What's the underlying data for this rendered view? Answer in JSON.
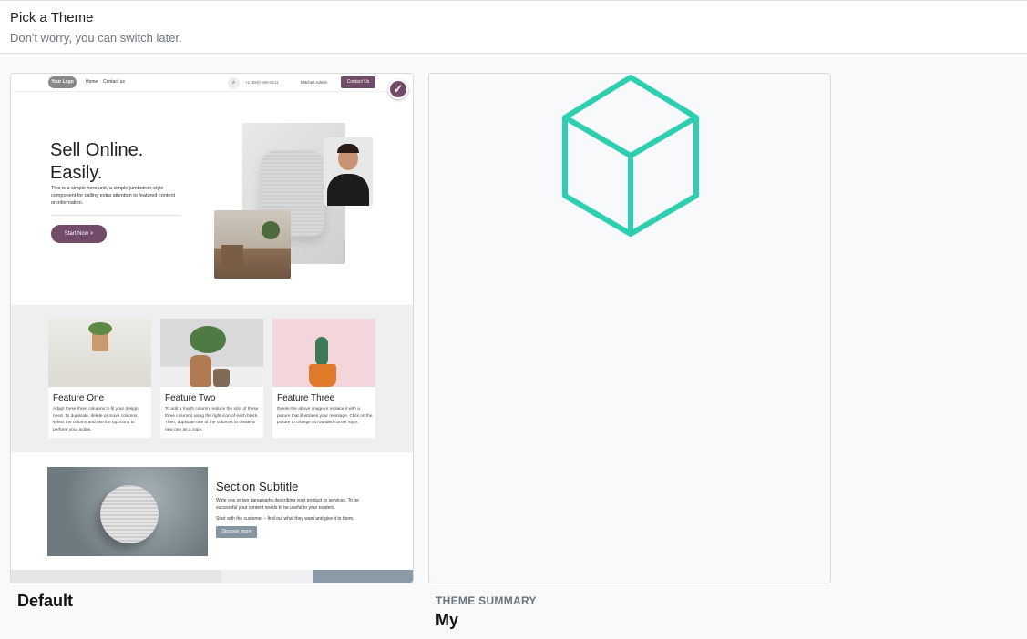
{
  "header": {
    "title": "Pick a Theme",
    "subtitle": "Don't worry, you can switch later."
  },
  "colors": {
    "accent": "#714b67",
    "cube_icon": "#2ecfb0"
  },
  "themes": [
    {
      "name": "Default",
      "selected": true,
      "preview": {
        "logo": "Your Logo",
        "nav_links": [
          "Home",
          "Contact us"
        ],
        "search_icon": "search-icon",
        "phone": "+1 (650) 555-0111",
        "user": "Mitchell Admin",
        "contact_button": "Contact Us",
        "hero_title_line1": "Sell Online.",
        "hero_title_line2": "Easily.",
        "hero_text": "This is a simple hero unit, a simple jumbotron-style component for calling extra attention to featured content or information.",
        "hero_button": "Start Now  >",
        "features": [
          {
            "title": "Feature One",
            "text": "Adapt these three columns to fit your design need. To duplicate, delete or move columns, select the column and use the top icons to perform your action."
          },
          {
            "title": "Feature Two",
            "text": "To add a fourth column, reduce the size of these three columns using the right icon of each block. Then, duplicate one of the columns to create a new one as a copy."
          },
          {
            "title": "Feature Three",
            "text": "Delete the above image or replace it with a picture that illustrates your message. Click on the picture to change its rounded corner style."
          }
        ],
        "section_title": "Section Subtitle",
        "section_text": "Write one or two paragraphs describing your product or services. To be successful your content needs to be useful to your readers.",
        "section_text2": "Start with the customer – find out what they want and give it to them.",
        "section_button": "Discover more"
      }
    },
    {
      "label": "THEME SUMMARY",
      "name": "My",
      "selected": false,
      "icon": "cube-icon"
    }
  ]
}
